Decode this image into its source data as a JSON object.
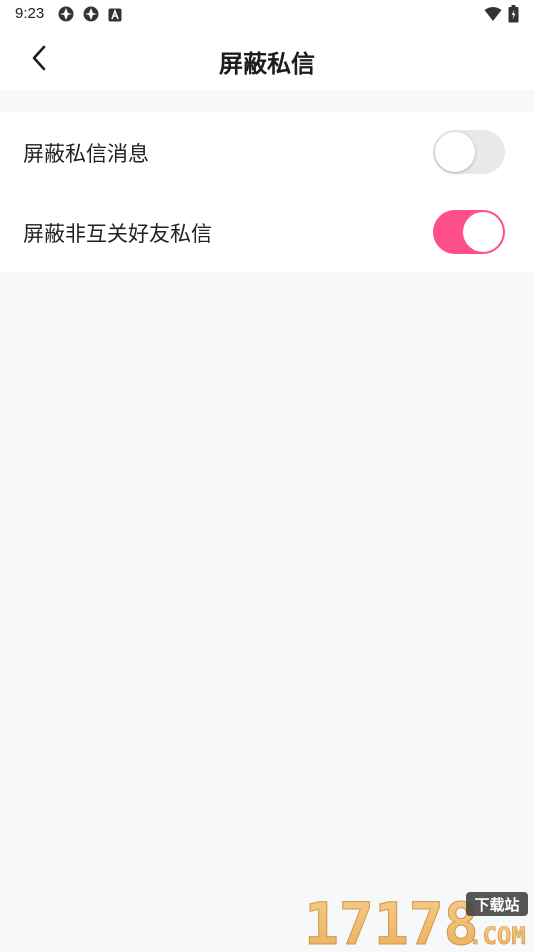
{
  "status_bar": {
    "time": "9:23",
    "left_icons": [
      "app-notification-icon",
      "app-notification-icon",
      "keyboard-a-icon"
    ],
    "right_icons": [
      "wifi-icon",
      "battery-icon"
    ]
  },
  "app_bar": {
    "back_icon": "chevron-left-icon",
    "title": "屏蔽私信"
  },
  "settings": [
    {
      "label": "屏蔽私信消息",
      "enabled": false
    },
    {
      "label": "屏蔽非互关好友私信",
      "enabled": true
    }
  ],
  "watermark": {
    "logo_text": "17178",
    "badge_text": "下载站",
    "domain_text": ".COM"
  },
  "colors": {
    "accent": "#ff4f8b",
    "background": "#f7f8fa",
    "toggle_off": "#e9e9eb"
  }
}
